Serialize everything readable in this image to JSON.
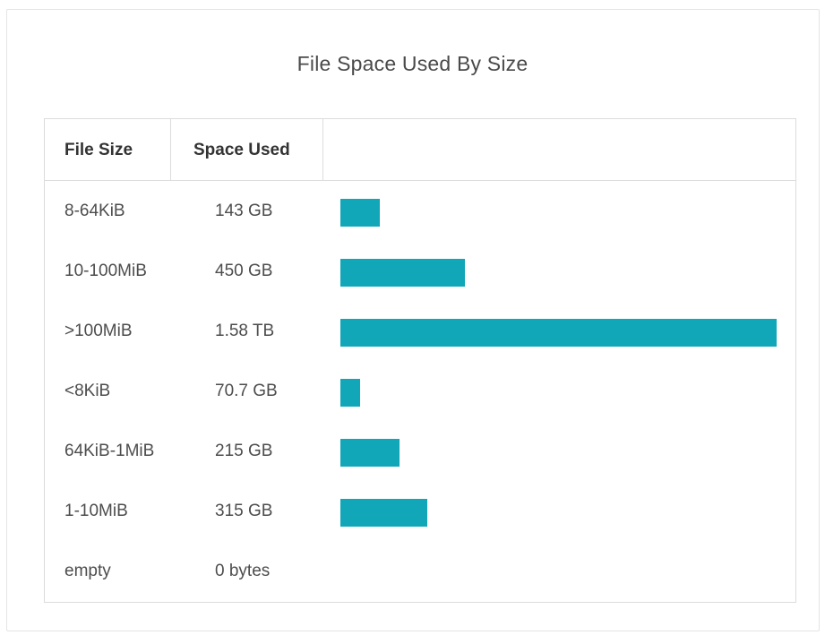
{
  "chart_data": {
    "type": "bar",
    "title": "File Space Used By Size",
    "columns": [
      "File Size",
      "Space Used"
    ],
    "unit_basis": "GB",
    "categories": [
      "8-64KiB",
      "10-100MiB",
      ">100MiB",
      "<8KiB",
      "64KiB-1MiB",
      "1-10MiB",
      "empty"
    ],
    "labels": [
      "143 GB",
      "450 GB",
      "1.58 TB",
      "70.7 GB",
      "215 GB",
      "315 GB",
      "0 bytes"
    ],
    "values": [
      143,
      450,
      1580,
      70.7,
      215,
      315,
      0
    ],
    "bar_color": "#11a7b8",
    "orientation": "horizontal",
    "grid": false,
    "legend": "none"
  }
}
